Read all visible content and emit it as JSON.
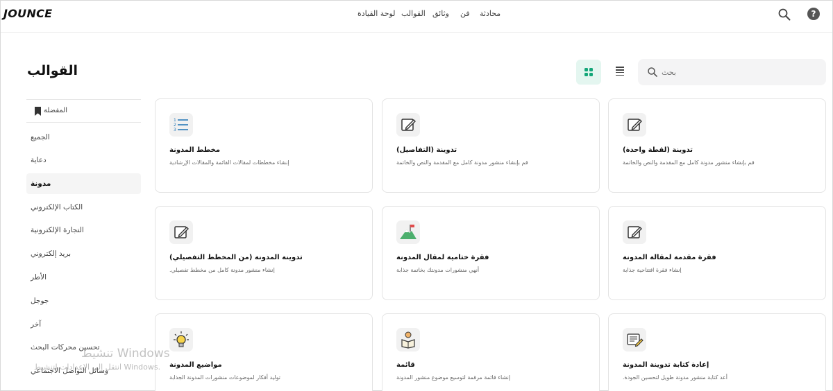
{
  "app": {
    "logo": "JOUNCE"
  },
  "topnav": {
    "dashboard": "لوحة القيادة",
    "templates": "القوالب",
    "documents": "وثائق",
    "art": "فن",
    "chat": "محادثة"
  },
  "page": {
    "title": "القوالب",
    "search_placeholder": "بحث"
  },
  "sidebar": {
    "favorites": "المفضلة",
    "items": [
      {
        "label": "الجميع"
      },
      {
        "label": "دعاية"
      },
      {
        "label": "مدونة",
        "active": true
      },
      {
        "label": "الكتاب الإلكتروني"
      },
      {
        "label": "التجارة الإلكترونية"
      },
      {
        "label": "بريد إلكتروني"
      },
      {
        "label": "الأطر"
      },
      {
        "label": "جوجل"
      },
      {
        "label": "آخر"
      },
      {
        "label": "تحسين محركات البحث"
      },
      {
        "label": "وسائل التواصل الاجتماعي"
      }
    ]
  },
  "cards": [
    {
      "title": "مخطط المدونة",
      "desc": "إنشاء مخططات لمقالات القائمة والمقالات الإرشادية",
      "icon": "list-outline-icon"
    },
    {
      "title": "تدوينة (التفاصيل)",
      "desc": "قم بإنشاء منشور مدونة كامل مع المقدمة والنص والخاتمة",
      "icon": "edit-icon"
    },
    {
      "title": "تدوينة (لقطة واحدة)",
      "desc": "قم بإنشاء منشور مدونة كامل مع المقدمة والنص والخاتمة",
      "icon": "edit-icon"
    },
    {
      "title": "تدوينة المدونة (من المخطط التفصيلي)",
      "desc": "إنشاء منشور مدونة كامل من مخطط تفصيلي.",
      "icon": "edit-icon"
    },
    {
      "title": "فقرة ختامية لمقال المدونة",
      "desc": "أنهي منشورات مدونتك بخاتمة جذابة",
      "icon": "mountain-flag-icon"
    },
    {
      "title": "فقرة مقدمة لمقالة المدونة",
      "desc": "إنشاء فقرة افتتاحية جذابة",
      "icon": "edit-icon"
    },
    {
      "title": "مواضيع المدونة",
      "desc": "توليد أفكار لموضوعات منشورات المدونة الجذابة",
      "icon": "lightbulb-icon"
    },
    {
      "title": "قائمة",
      "desc": "إنشاء قائمة مرقمة لتوسيع موضوع منشور المدونة",
      "icon": "reading-person-icon"
    },
    {
      "title": "إعادة كتابة تدوينة المدونة",
      "desc": "أعد كتابة منشور مدونة طويل لتحسين الجودة.",
      "icon": "rewrite-note-icon"
    }
  ],
  "watermark": {
    "line1": "تنشيط Windows",
    "line2": "انتقل إلى الإعدادات لتنشيط Windows."
  },
  "colors": {
    "accent": "#12a678",
    "accent_bg": "#e4f6f0"
  }
}
